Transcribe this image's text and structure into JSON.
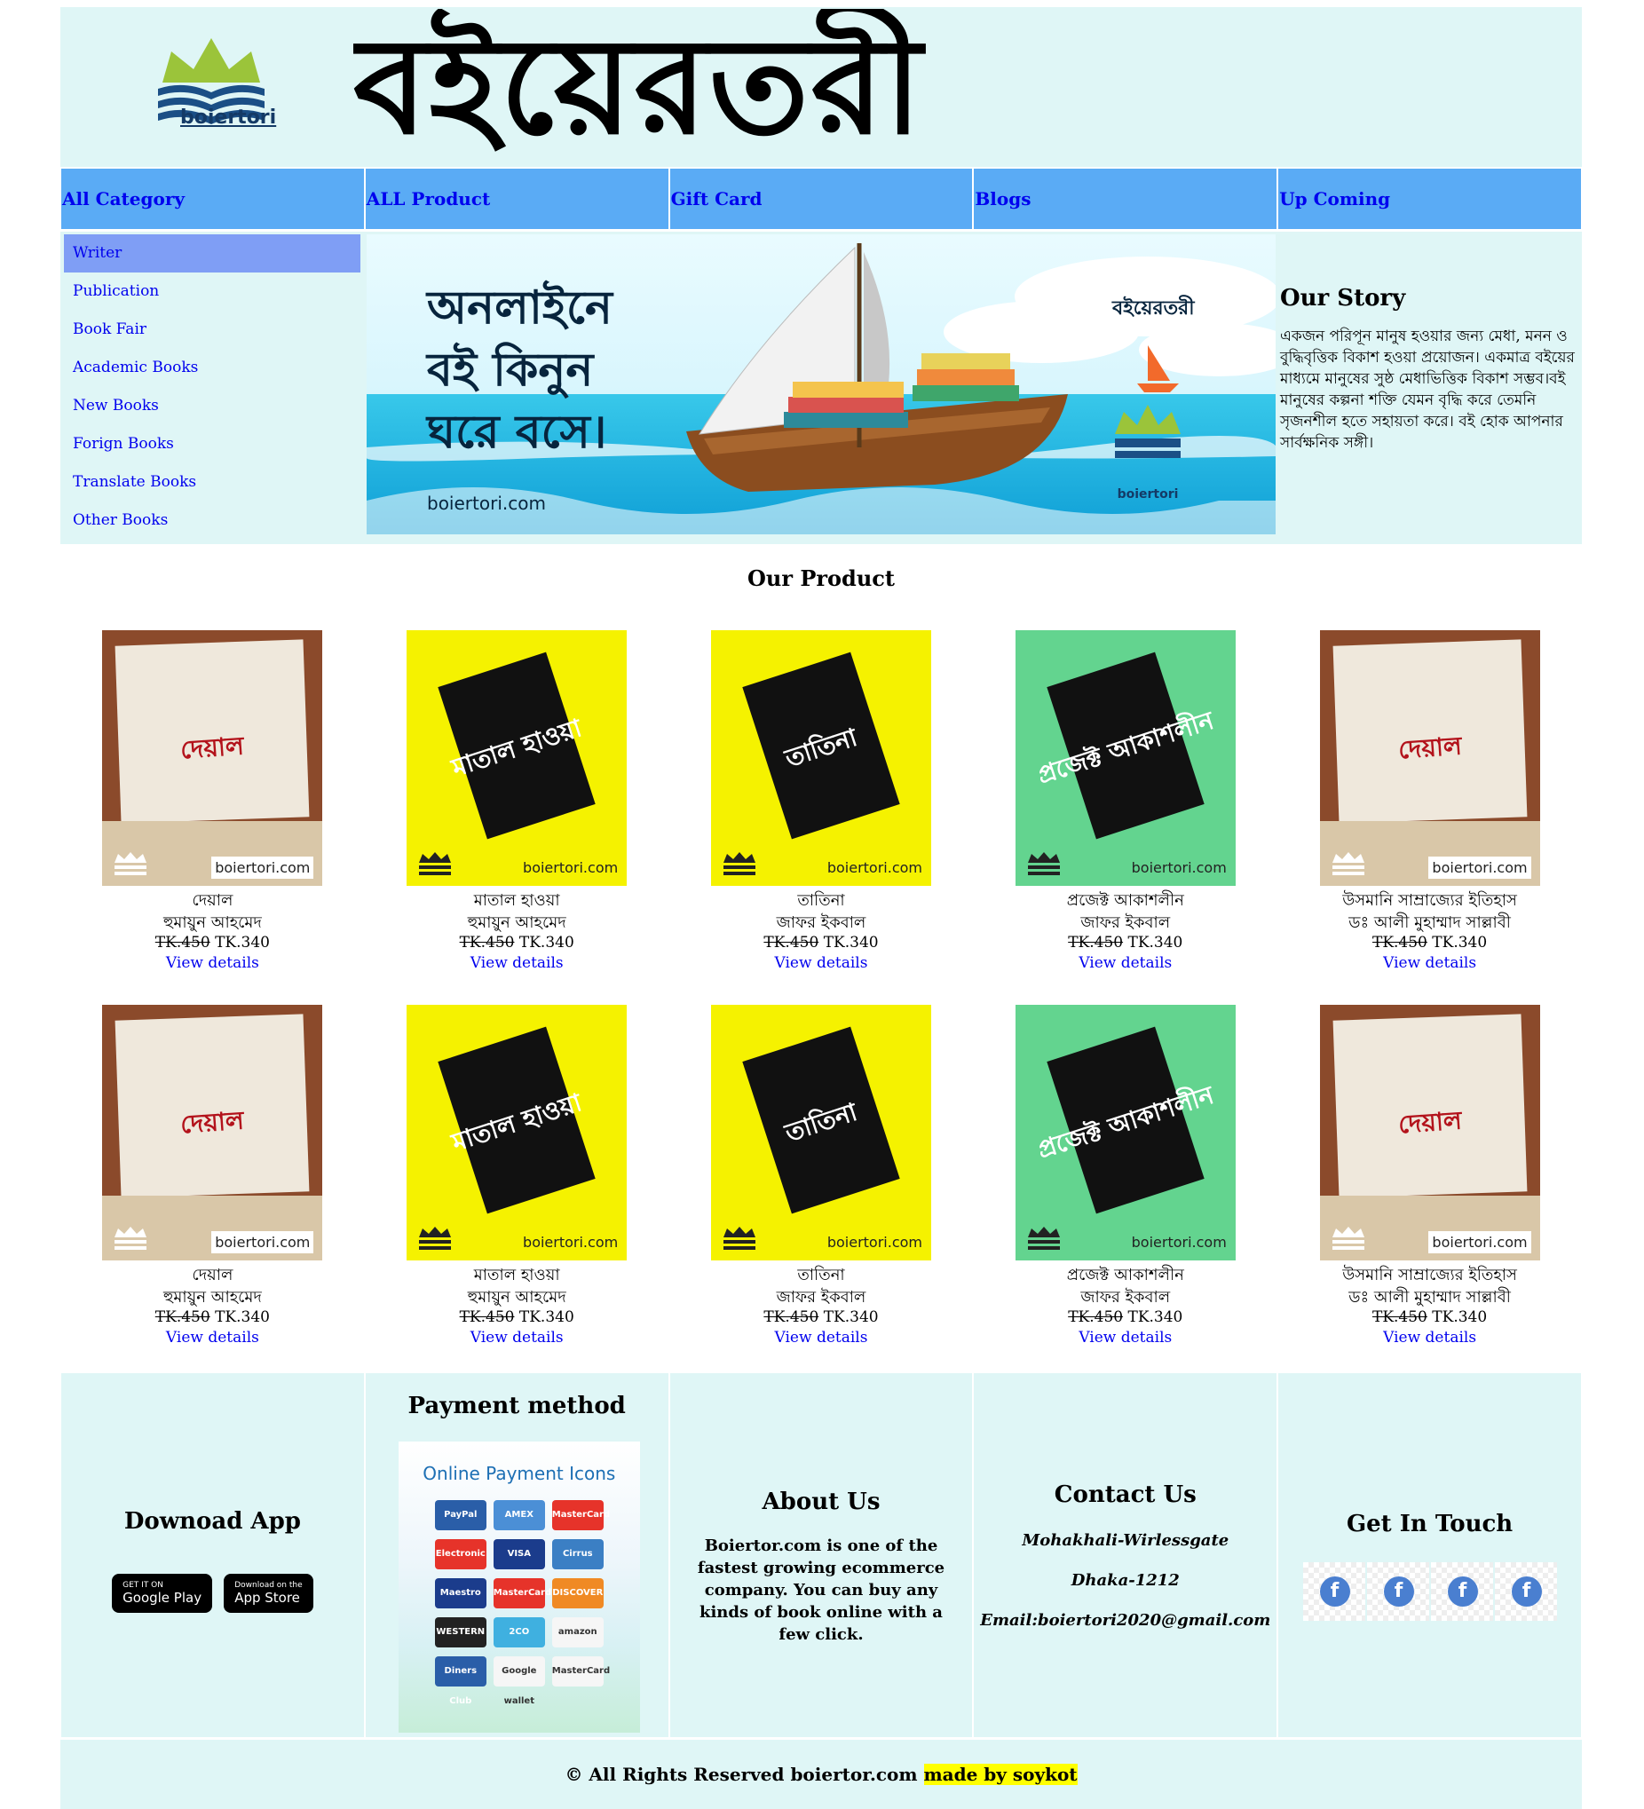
{
  "header": {
    "logo_text": "boiertori",
    "wordmark": "বইয়েরতরী"
  },
  "nav": [
    "All Category",
    "ALL Product",
    "Gift Card",
    "Blogs",
    "Up Coming"
  ],
  "sidebar": [
    "Writer",
    "Publication",
    "Book Fair",
    "Academic Books",
    "New Books",
    "Forign Books",
    "Translate Books",
    "Other Books"
  ],
  "banner": {
    "line1": "অনলাইনে",
    "line2": "বই কিনুন",
    "line3": "ঘরে বসে।",
    "site": "boiertori.com",
    "brand": "বইয়েরতরী",
    "logo_text": "boiertori"
  },
  "story": {
    "title": "Our Story",
    "text": "একজন পরিপূন মানুষ হওয়ার জন্য মেধা, মনন ও বুদ্ধিবৃত্তিক বিকাশ হওয়া প্রয়োজন। একমাত্র বইয়ের মাধ্যমে মানুষের সুষ্ঠ মেধাভিত্তিক বিকাশ সম্ভব।বই মানুষের কল্পনা শক্তি যেমন বৃদ্ধি করে তেমনি সৃজনশীল হতে সহায়তা করে। বই হোক আপনার সার্বক্ষনিক সঙ্গী।"
  },
  "products_title": "Our Product",
  "products": [
    {
      "title": "দেয়াল",
      "author": "হুমায়ুন আহমেদ",
      "old_price": "TK.450",
      "price": "TK.340",
      "link": "View details",
      "cover_text": "দেয়াল",
      "watermark": "boiertori.com",
      "bg": "#8b4a2b"
    },
    {
      "title": "মাতাল হাওয়া",
      "author": "হুমায়ুন আহমেদ",
      "old_price": "TK.450",
      "price": "TK.340",
      "link": "View details",
      "cover_text": "মাতাল হাওয়া",
      "watermark": "boiertori.com",
      "bg": "#f5f200"
    },
    {
      "title": "তাতিনা",
      "author": "জাফর ইকবাল",
      "old_price": "TK.450",
      "price": "TK.340",
      "link": "View details",
      "cover_text": "তাতিনা",
      "watermark": "boiertori.com",
      "bg": "#f5f200"
    },
    {
      "title": "প্রজেক্ট আকাশলীন",
      "author": "জাফর ইকবাল",
      "old_price": "TK.450",
      "price": "TK.340",
      "link": "View details",
      "cover_text": "প্রজেক্ট আকাশলীন",
      "watermark": "boiertori.com",
      "bg": "#63d48f"
    },
    {
      "title": "উসমানি সাম্রাজ্যের ইতিহাস",
      "author": "ডঃ আলী মুহাম্মাদ সাল্লাবী",
      "old_price": "TK.450",
      "price": "TK.340",
      "link": "View details",
      "cover_text": "দেয়াল",
      "watermark": "boiertori.com",
      "bg": "#8b4a2b"
    },
    {
      "title": "দেয়াল",
      "author": "হুমায়ুন আহমেদ",
      "old_price": "TK.450",
      "price": "TK.340",
      "link": "View details",
      "cover_text": "দেয়াল",
      "watermark": "boiertori.com",
      "bg": "#8b4a2b"
    },
    {
      "title": "মাতাল হাওয়া",
      "author": "হুমায়ুন আহমেদ",
      "old_price": "TK.450",
      "price": "TK.340",
      "link": "View details",
      "cover_text": "মাতাল হাওয়া",
      "watermark": "boiertori.com",
      "bg": "#f5f200"
    },
    {
      "title": "তাতিনা",
      "author": "জাফর ইকবাল",
      "old_price": "TK.450",
      "price": "TK.340",
      "link": "View details",
      "cover_text": "তাতিনা",
      "watermark": "boiertori.com",
      "bg": "#f5f200"
    },
    {
      "title": "প্রজেক্ট আকাশলীন",
      "author": "জাফর ইকবাল",
      "old_price": "TK.450",
      "price": "TK.340",
      "link": "View details",
      "cover_text": "প্রজেক্ট আকাশলীন",
      "watermark": "boiertori.com",
      "bg": "#63d48f"
    },
    {
      "title": "উসমানি সাম্রাজ্যের ইতিহাস",
      "author": "ডঃ আলী মুহাম্মাদ সাল্লাবী",
      "old_price": "TK.450",
      "price": "TK.340",
      "link": "View details",
      "cover_text": "দেয়াল",
      "watermark": "boiertori.com",
      "bg": "#8b4a2b"
    }
  ],
  "footer": {
    "download_title": "Downoad App",
    "google_small": "GET IT ON",
    "google_label": "Google Play",
    "apple_small": "Download on the",
    "apple_label": "App Store",
    "payment_title": "Payment method",
    "payment_image_title": "Online Payment Icons",
    "payment_icons": [
      "PayPal",
      "AMEX",
      "MasterCard",
      "Electronic",
      "VISA",
      "Cirrus",
      "Maestro",
      "MasterCard",
      "DISCOVER",
      "WESTERN UNION",
      "2CO",
      "amazon",
      "Diners Club",
      "Google wallet",
      "MasterCard"
    ],
    "about_title": "About Us",
    "about_text": "Boiertor.com is one of the fastest growing ecommerce company. You can buy any kinds of book online with a few click.",
    "contact_title": "Contact Us",
    "contact_lines": [
      "Mohakhali-Wirlessgate",
      "Dhaka-1212",
      "Email:boiertori2020@gmail.com"
    ],
    "touch_title": "Get In Touch",
    "social_icons": [
      "facebook-icon",
      "facebook-icon",
      "facebook-icon",
      "facebook-icon"
    ]
  },
  "bottom": {
    "rights": "© All Rights Reserved boiertor.com",
    "made_by": "made by soykot"
  },
  "colors": {
    "panel": "#dff6f6",
    "nav": "#5aabf5",
    "sidebar_active": "#7f9ef5",
    "link": "#0000ee",
    "highlight": "#ffff00"
  }
}
